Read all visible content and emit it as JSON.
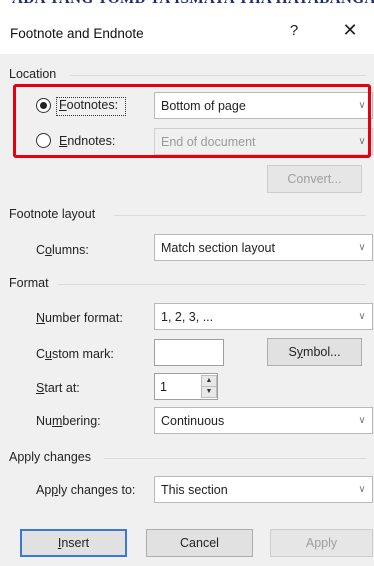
{
  "background_text": "ADA YANG TOMD TA ISMAYA THA HAYABANGAN",
  "dialog": {
    "title": "Footnote and Endnote",
    "help_label": "?",
    "close_label": "✕"
  },
  "location": {
    "heading": "Location",
    "footnotes": {
      "label_accel": "F",
      "label_rest": "ootnotes:",
      "value": "Bottom of page",
      "selected": true
    },
    "endnotes": {
      "label_accel": "E",
      "label_rest": "ndnotes:",
      "value": "End of document",
      "selected": false
    },
    "convert_label": "Convert..."
  },
  "footnote_layout": {
    "heading": "Footnote layout",
    "columns": {
      "label_pre": "C",
      "label_accel": "o",
      "label_rest": "lumns:",
      "value": "Match section layout"
    }
  },
  "format": {
    "heading": "Format",
    "number_format": {
      "label_accel": "N",
      "label_rest": "umber format:",
      "value": "1, 2, 3, ..."
    },
    "custom_mark": {
      "label_pre": "C",
      "label_accel": "u",
      "label_rest": "stom mark:",
      "value": ""
    },
    "symbol_label_pre": "S",
    "symbol_label_accel": "y",
    "symbol_label_rest": "mbol...",
    "start_at": {
      "label_accel": "S",
      "label_rest": "tart at:",
      "value": "1"
    },
    "numbering": {
      "label_pre": "Nu",
      "label_accel": "m",
      "label_rest": "bering:",
      "value": "Continuous"
    }
  },
  "apply_changes": {
    "heading": "Apply changes",
    "apply_to": {
      "label_pre": "Ap",
      "label_accel": "p",
      "label_rest": "ly changes to:",
      "value": "This section"
    }
  },
  "buttons": {
    "insert_accel": "I",
    "insert_rest": "nsert",
    "cancel": "Cancel",
    "apply": "Apply"
  },
  "colors": {
    "highlight": "#e4000f",
    "dialog_bg": "#f0f0f0",
    "default_button_border": "#3b78d4"
  },
  "icons": {
    "dropdown": "chevron-down-icon",
    "spin_up": "spin-up-icon",
    "spin_down": "spin-down-icon"
  }
}
